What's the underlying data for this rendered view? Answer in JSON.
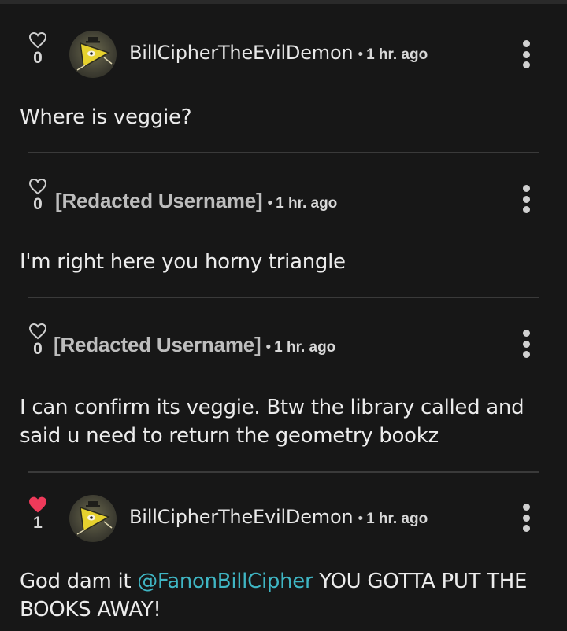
{
  "colors": {
    "background": "#171717",
    "text": "#ececec",
    "mention": "#3fb6c4",
    "heart_liked": "#ee3a5a",
    "heart_outline": "#cfcfcf",
    "divider": "#3a3a3a"
  },
  "comments": [
    {
      "likes": "0",
      "liked": false,
      "has_avatar": true,
      "username": "BillCipherTheEvilDemon",
      "separator": "•",
      "time": "1 hr. ago",
      "body_before": "Where is veggie?"
    },
    {
      "likes": "0",
      "liked": false,
      "has_avatar": false,
      "username": "[Redacted Username]",
      "separator": "•",
      "time": "1 hr. ago",
      "body_before": "I'm right here you horny triangle"
    },
    {
      "likes": "0",
      "liked": false,
      "has_avatar": false,
      "username": "[Redacted Username]",
      "separator": "•",
      "time": "1 hr. ago",
      "body_before": "I can confirm its veggie. Btw the library called and said u need to return the geometry bookz"
    },
    {
      "likes": "1",
      "liked": true,
      "has_avatar": true,
      "username": "BillCipherTheEvilDemon",
      "separator": "•",
      "time": "1 hr. ago",
      "body_before": "God dam it ",
      "mention": "@FanonBillCipher",
      "body_after": " YOU GOTTA PUT THE BOOKS AWAY!"
    }
  ]
}
